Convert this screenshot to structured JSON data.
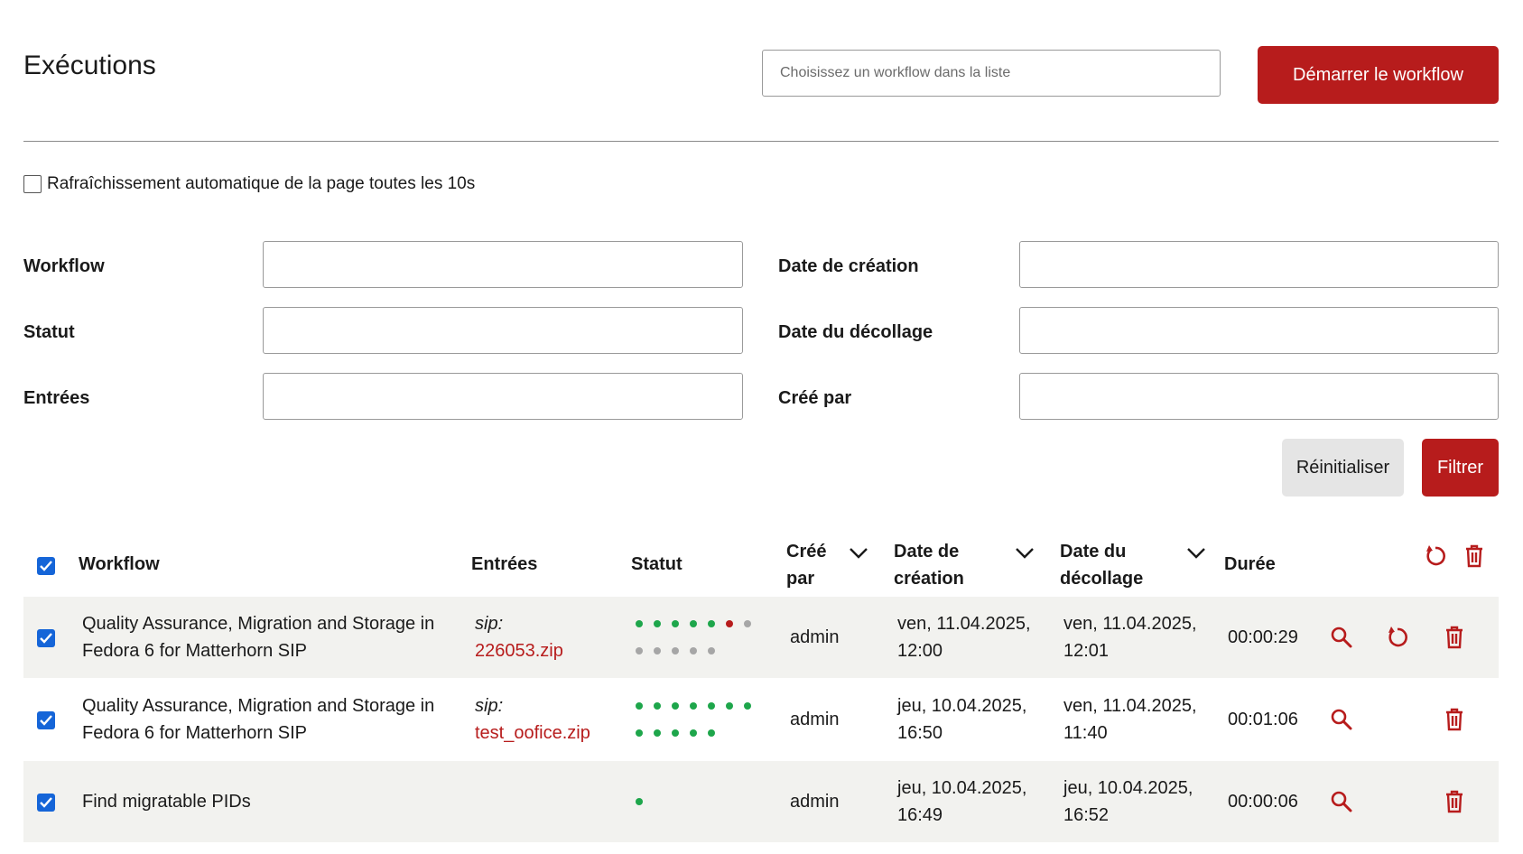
{
  "header": {
    "title": "Exécutions",
    "workflow_select_placeholder": "Choisissez un workflow dans la liste",
    "start_button": "Démarrer le workflow"
  },
  "refresh": {
    "label": "Rafraîchissement automatique de la page toutes les 10s",
    "checked": false
  },
  "filters": {
    "workflow_label": "Workflow",
    "status_label": "Statut",
    "inputs_label": "Entrées",
    "created_date_label": "Date de création",
    "takeoff_date_label": "Date du décollage",
    "created_by_label": "Créé par",
    "reset_button": "Réinitialiser",
    "filter_button": "Filtrer"
  },
  "table": {
    "columns": {
      "workflow": "Workflow",
      "inputs": "Entrées",
      "status": "Statut",
      "created_by_1": "Créé",
      "created_by_2": "par",
      "created_date_1": "Date de",
      "created_date_2": "création",
      "takeoff_date_1": "Date du",
      "takeoff_date_2": "décollage",
      "duration": "Durée"
    },
    "rows": [
      {
        "workflow_1": "Quality Assurance, Migration and Storage in",
        "workflow_2": "Fedora 6 for Matterhorn SIP",
        "input_label": "sip:",
        "input_file": "226053.zip",
        "status_dots": [
          [
            "green",
            "green",
            "green",
            "green",
            "green",
            "red",
            "gray"
          ],
          [
            "gray",
            "gray",
            "gray",
            "gray",
            "gray"
          ]
        ],
        "created_by": "admin",
        "created_date_1": "ven, 11.04.2025,",
        "created_date_2": "12:00",
        "takeoff_date_1": "ven, 11.04.2025,",
        "takeoff_date_2": "12:01",
        "duration": "00:00:29",
        "restartable": true
      },
      {
        "workflow_1": "Quality Assurance, Migration and Storage in",
        "workflow_2": "Fedora 6 for Matterhorn SIP",
        "input_label": "sip:",
        "input_file": "test_oofice.zip",
        "status_dots": [
          [
            "green",
            "green",
            "green",
            "green",
            "green",
            "green",
            "green"
          ],
          [
            "green",
            "green",
            "green",
            "green",
            "green"
          ]
        ],
        "created_by": "admin",
        "created_date_1": "jeu, 10.04.2025,",
        "created_date_2": "16:50",
        "takeoff_date_1": "ven, 11.04.2025,",
        "takeoff_date_2": "11:40",
        "duration": "00:01:06",
        "restartable": false
      },
      {
        "workflow_1": "Find migratable PIDs",
        "workflow_2": "",
        "input_label": "",
        "input_file": "",
        "status_dots": [
          [
            "green"
          ]
        ],
        "created_by": "admin",
        "created_date_1": "jeu, 10.04.2025,",
        "created_date_2": "16:49",
        "takeoff_date_1": "jeu, 10.04.2025,",
        "takeoff_date_2": "16:52",
        "duration": "00:00:06",
        "restartable": false
      }
    ]
  },
  "colors": {
    "accent": "#b71c1c",
    "checkbox": "#1565d8",
    "dot_green": "#1ea64b",
    "dot_red": "#b71c1c",
    "dot_gray": "#a6a6a6",
    "row_alt": "#f2f2ef"
  }
}
